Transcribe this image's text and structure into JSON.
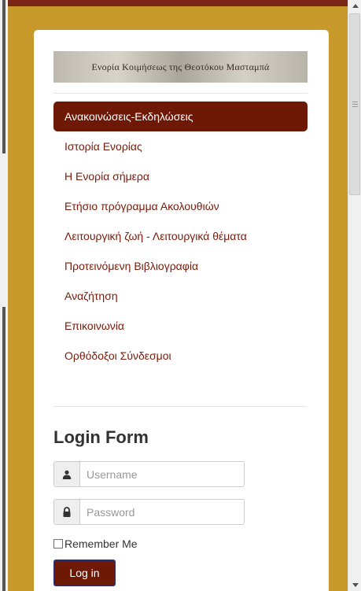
{
  "banner": {
    "text": "Ενορία Κοιμήσεως της Θεοτόκου Μασταμπά"
  },
  "menu": {
    "items": [
      {
        "label": "Ανακοινώσεις-Εκδηλώσεις"
      },
      {
        "label": "Ιστορία Ενορίας"
      },
      {
        "label": "Η Ενορία σήμερα"
      },
      {
        "label": "Ετήσιο πρόγραμμα Ακολουθιών"
      },
      {
        "label": "Λειτουργική ζωή - Λειτουργικά θέματα"
      },
      {
        "label": "Προτεινόμενη Βιβλιογραφία"
      },
      {
        "label": "Αναζήτηση"
      },
      {
        "label": "Επικοινωνία"
      },
      {
        "label": "Ορθόδοξοι Σύνδεσμοι"
      }
    ]
  },
  "login": {
    "title": "Login Form",
    "username_placeholder": "Username",
    "username_value": "",
    "password_placeholder": "Password",
    "password_value": "",
    "remember_label": "Remember Me",
    "remember_checked": false,
    "submit_label": "Log in"
  },
  "colors": {
    "frame": "#c89a2b",
    "frame_top": "#7a2416",
    "menu_active_bg": "#6e1806",
    "menu_text": "#7a1a0a",
    "button_border": "#2a2e6e"
  },
  "icons": {
    "username": "user-icon",
    "password": "lock-icon"
  }
}
